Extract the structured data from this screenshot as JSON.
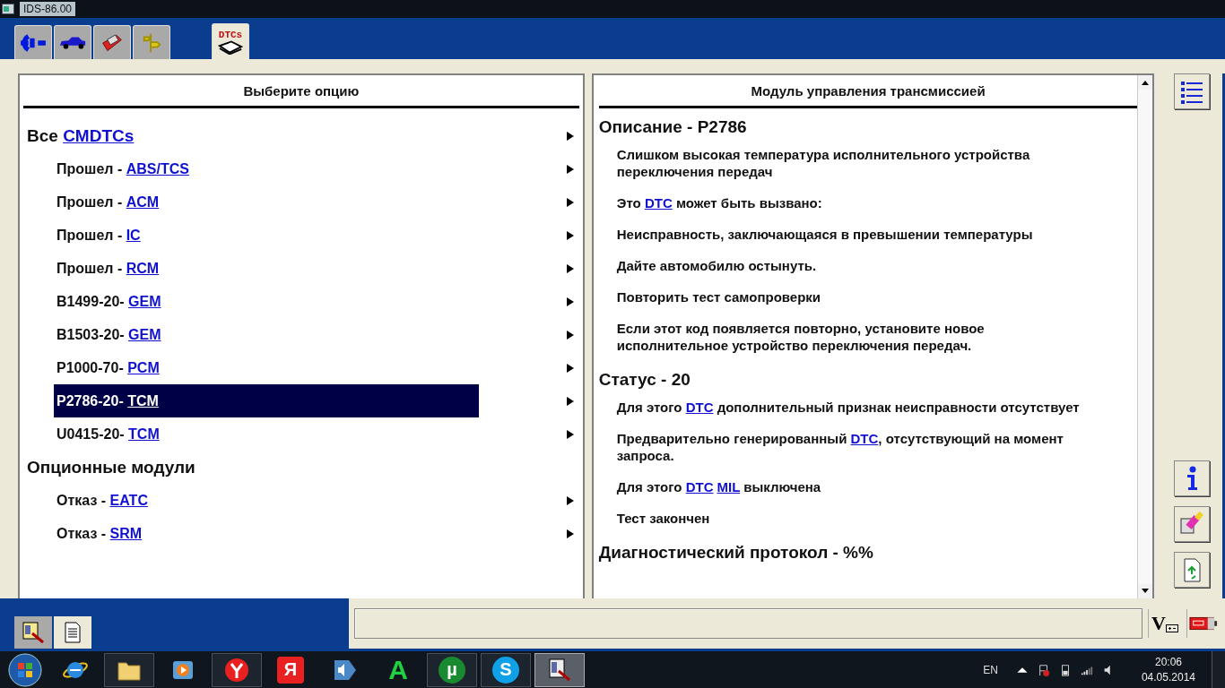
{
  "window": {
    "title": "IDS-86.00"
  },
  "top_tabs": [
    {
      "kind": "connect",
      "selected": false
    },
    {
      "kind": "vehicle",
      "selected": false
    },
    {
      "kind": "toolbox",
      "selected": false
    },
    {
      "kind": "signpost",
      "selected": false
    },
    {
      "kind": "dtc",
      "label": "DTCs",
      "selected": true
    }
  ],
  "left_panel": {
    "title": "Выберите опцию",
    "rows": [
      {
        "kind": "group",
        "text": "Все ",
        "link": "CMDTCs",
        "selected": false
      },
      {
        "kind": "item",
        "text": "Прошел - ",
        "link": "ABS/TCS",
        "selected": false
      },
      {
        "kind": "item",
        "text": "Прошел - ",
        "link": "ACM",
        "selected": false
      },
      {
        "kind": "item",
        "text": "Прошел - ",
        "link": "IC",
        "selected": false
      },
      {
        "kind": "item",
        "text": "Прошел - ",
        "link": "RCM",
        "selected": false
      },
      {
        "kind": "item",
        "text": "B1499-20- ",
        "link": "GEM",
        "selected": false
      },
      {
        "kind": "item",
        "text": "B1503-20- ",
        "link": "GEM",
        "selected": false
      },
      {
        "kind": "item",
        "text": "P1000-70- ",
        "link": "PCM",
        "selected": false
      },
      {
        "kind": "item",
        "text": "P2786-20- ",
        "link": "TCM",
        "selected": true
      },
      {
        "kind": "item",
        "text": "U0415-20- ",
        "link": "TCM",
        "selected": false
      },
      {
        "kind": "group",
        "text": "Опционные модули",
        "selected": false
      },
      {
        "kind": "item",
        "text": "Отказ - ",
        "link": "EATC",
        "selected": false
      },
      {
        "kind": "item",
        "text": "Отказ - ",
        "link": "SRM",
        "selected": false
      }
    ]
  },
  "right_panel": {
    "title": "Модуль управления трансмиссией",
    "blocks": [
      {
        "kind": "heading",
        "parts": [
          {
            "text": "Описание - P2786"
          }
        ]
      },
      {
        "kind": "para",
        "parts": [
          {
            "text": "Слишком высокая температура исполнительного устройства переключения передач"
          }
        ]
      },
      {
        "kind": "para",
        "parts": [
          {
            "text": "Это "
          },
          {
            "text": "DTC",
            "kind": "link"
          },
          {
            "text": " может быть вызвано:"
          }
        ]
      },
      {
        "kind": "para",
        "parts": [
          {
            "text": "Неисправность, заключающаяся в превышении температуры"
          }
        ]
      },
      {
        "kind": "para",
        "parts": [
          {
            "text": "Дайте автомобилю остынуть."
          }
        ]
      },
      {
        "kind": "para",
        "parts": [
          {
            "text": "Повторить тест самопроверки"
          }
        ]
      },
      {
        "kind": "para",
        "parts": [
          {
            "text": "Если этот код появляется повторно, установите новое исполнительное устройство переключения передач."
          }
        ]
      },
      {
        "kind": "heading",
        "parts": [
          {
            "text": "Статус - 20"
          }
        ]
      },
      {
        "kind": "para",
        "parts": [
          {
            "text": "Для этого "
          },
          {
            "text": "DTC",
            "kind": "link"
          },
          {
            "text": " дополнительный признак неисправности отсутствует"
          }
        ]
      },
      {
        "kind": "para",
        "parts": [
          {
            "text": "Предварительно генерированный "
          },
          {
            "text": "DTC",
            "kind": "link"
          },
          {
            "text": ", отсутствующий на момент запроса."
          }
        ]
      },
      {
        "kind": "para",
        "parts": [
          {
            "text": "Для этого "
          },
          {
            "text": "DTC",
            "kind": "link"
          },
          {
            "text": "MIL",
            "kind": "link"
          },
          {
            "text": " выключена"
          }
        ]
      },
      {
        "kind": "para",
        "parts": [
          {
            "text": "Тест закончен"
          }
        ]
      },
      {
        "kind": "heading",
        "parts": [
          {
            "text": "Диагностический протокол - %%"
          }
        ]
      }
    ]
  },
  "side_tools": [
    {
      "kind": "list"
    },
    {
      "kind": "info"
    },
    {
      "kind": "eraser"
    },
    {
      "kind": "refresh"
    }
  ],
  "bottom_tabs": [
    {
      "kind": "device",
      "selected": false
    },
    {
      "kind": "document",
      "selected": true
    }
  ],
  "status_icons": [
    {
      "kind": "voltage",
      "label": "V"
    },
    {
      "kind": "battery"
    }
  ],
  "taskbar": {
    "apps": [
      {
        "kind": "ie",
        "running": false
      },
      {
        "kind": "folder",
        "running": true
      },
      {
        "kind": "media",
        "running": false
      },
      {
        "kind": "browser",
        "running": true
      },
      {
        "kind": "ya",
        "label": "Я",
        "running": false
      },
      {
        "kind": "sound",
        "running": false
      },
      {
        "kind": "a",
        "label": "A",
        "running": false
      },
      {
        "kind": "torrent",
        "label": "µ",
        "running": true
      },
      {
        "kind": "skype",
        "label": "S",
        "running": true
      },
      {
        "kind": "ids",
        "running": true,
        "selected": true
      }
    ],
    "language": "EN",
    "time": "20:06",
    "date": "04.05.2014"
  }
}
